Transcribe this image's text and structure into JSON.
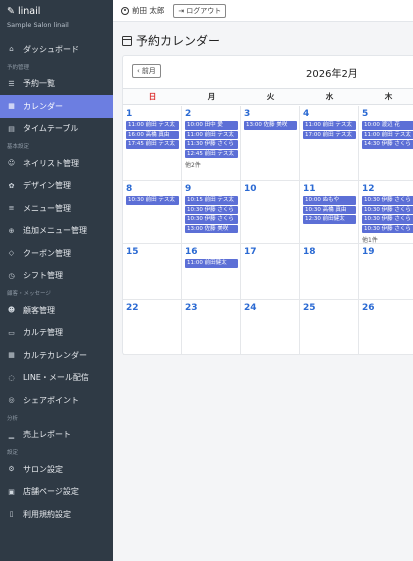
{
  "brand": {
    "title": "linail",
    "subtitle": "Sample Salon linail"
  },
  "sidebar": {
    "items": [
      {
        "type": "item",
        "label": "ダッシュボード",
        "icon": "home-icon",
        "glyph": "⌂",
        "name": "sidebar-item-dashboard"
      },
      {
        "type": "section",
        "label": "予約管理"
      },
      {
        "type": "item",
        "label": "予約一覧",
        "icon": "list-icon",
        "glyph": "☰",
        "name": "sidebar-item-reservations"
      },
      {
        "type": "item",
        "label": "カレンダー",
        "icon": "calendar-icon",
        "glyph": "▦",
        "name": "sidebar-item-calendar",
        "active": true
      },
      {
        "type": "item",
        "label": "タイムテーブル",
        "icon": "table-icon",
        "glyph": "▤",
        "name": "sidebar-item-timetable"
      },
      {
        "type": "section",
        "label": "基本設定"
      },
      {
        "type": "item",
        "label": "ネイリスト管理",
        "icon": "users-icon",
        "glyph": "☺",
        "name": "sidebar-item-nailists"
      },
      {
        "type": "item",
        "label": "デザイン管理",
        "icon": "palette-icon",
        "glyph": "✿",
        "name": "sidebar-item-designs"
      },
      {
        "type": "item",
        "label": "メニュー管理",
        "icon": "menu-icon",
        "glyph": "≡",
        "name": "sidebar-item-menu"
      },
      {
        "type": "item",
        "label": "追加メニュー管理",
        "icon": "plus-circle-icon",
        "glyph": "⊕",
        "name": "sidebar-item-extra-menu"
      },
      {
        "type": "item",
        "label": "クーポン管理",
        "icon": "tag-icon",
        "glyph": "◇",
        "name": "sidebar-item-coupons"
      },
      {
        "type": "item",
        "label": "シフト管理",
        "icon": "clock-icon",
        "glyph": "◷",
        "name": "sidebar-item-shifts"
      },
      {
        "type": "section",
        "label": "顧客・メッセージ"
      },
      {
        "type": "item",
        "label": "顧客管理",
        "icon": "customers-icon",
        "glyph": "☻",
        "name": "sidebar-item-customers"
      },
      {
        "type": "item",
        "label": "カルテ管理",
        "icon": "clipboard-icon",
        "glyph": "▭",
        "name": "sidebar-item-charts"
      },
      {
        "type": "item",
        "label": "カルテカレンダー",
        "icon": "calendar-icon",
        "glyph": "▦",
        "name": "sidebar-item-chart-calendar"
      },
      {
        "type": "item",
        "label": "LINE・メール配信",
        "icon": "chat-icon",
        "glyph": "◌",
        "name": "sidebar-item-line-mail"
      },
      {
        "type": "item",
        "label": "シェアポイント",
        "icon": "share-icon",
        "glyph": "◎",
        "name": "sidebar-item-share-point"
      },
      {
        "type": "section",
        "label": "分析"
      },
      {
        "type": "item",
        "label": "売上レポート",
        "icon": "chart-icon",
        "glyph": "▁",
        "name": "sidebar-item-sales-report"
      },
      {
        "type": "section",
        "label": "設定"
      },
      {
        "type": "item",
        "label": "サロン設定",
        "icon": "gear-icon",
        "glyph": "⚙",
        "name": "sidebar-item-salon-settings"
      },
      {
        "type": "item",
        "label": "店舗ページ設定",
        "icon": "store-icon",
        "glyph": "▣",
        "name": "sidebar-item-store-page"
      },
      {
        "type": "item",
        "label": "利用規約設定",
        "icon": "document-icon",
        "glyph": "▯",
        "name": "sidebar-item-terms"
      }
    ]
  },
  "header": {
    "user_name": "前田 太郎",
    "logout_label": "ログアウト"
  },
  "page": {
    "title": "予約カレンダー"
  },
  "calendar": {
    "prev_label": "前月",
    "month_label": "2026年2月",
    "weekdays": [
      "日",
      "月",
      "火",
      "水",
      "木"
    ],
    "weeks": [
      [
        {
          "day": "1",
          "events": [
            "11:00 前田 テス太",
            "16:00 高橋 真由",
            "17:45 前田 テス太"
          ]
        },
        {
          "day": "2",
          "events": [
            "10:00 田中 愛",
            "11:00 前田 テス太",
            "11:30 伊藤 さくら",
            "12:45 前田 テス太"
          ],
          "more": "他2件"
        },
        {
          "day": "3",
          "events": [
            "13:00 佐藤 美咲"
          ]
        },
        {
          "day": "4",
          "events": [
            "11:00 前田 テス太",
            "17:00 前田 テス太"
          ]
        },
        {
          "day": "5",
          "events": [
            "10:00 渡辺 花",
            "11:00 前田 テス太",
            "14:30 伊藤 さくら"
          ]
        }
      ],
      [
        {
          "day": "8",
          "events": [
            "10:30 前田 テス太"
          ]
        },
        {
          "day": "9",
          "events": [
            "10:15 前田 テス太",
            "10:30 伊藤 さくら",
            "10:30 伊藤 さくら",
            "13:00 佐藤 美咲"
          ]
        },
        {
          "day": "10",
          "events": []
        },
        {
          "day": "11",
          "events": [
            "10:00 ぬもや",
            "10:30 高橋 真由",
            "12:30 前田健太"
          ]
        },
        {
          "day": "12",
          "events": [
            "10:30 伊藤 さくら",
            "10:30 伊藤 さくら",
            "10:30 伊藤 さくら",
            "10:30 伊藤 さくら"
          ],
          "more": "他1件"
        }
      ],
      [
        {
          "day": "15",
          "events": []
        },
        {
          "day": "16",
          "events": [
            "11:00 前田健太"
          ]
        },
        {
          "day": "17",
          "events": []
        },
        {
          "day": "18",
          "events": []
        },
        {
          "day": "19",
          "events": []
        }
      ],
      [
        {
          "day": "22",
          "events": []
        },
        {
          "day": "23",
          "events": []
        },
        {
          "day": "24",
          "events": []
        },
        {
          "day": "25",
          "events": []
        },
        {
          "day": "26",
          "events": []
        }
      ]
    ]
  },
  "colors": {
    "sidebar_bg": "#2f3a45",
    "accent": "#6c7ee1",
    "event_bg": "#5c6fd6",
    "day_number": "#2b6ad3",
    "sunday": "#dd3333"
  }
}
